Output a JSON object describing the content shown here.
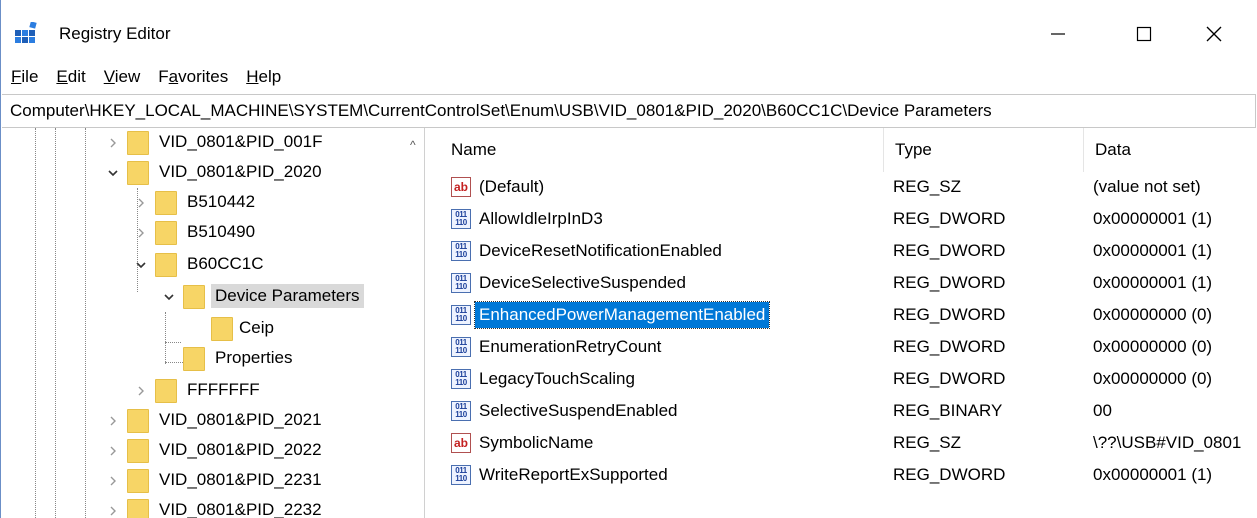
{
  "window": {
    "title": "Registry Editor",
    "controls": {
      "minimize": "—",
      "maximize": "☐",
      "close": "✕"
    }
  },
  "menu": [
    "File",
    "Edit",
    "View",
    "Favorites",
    "Help"
  ],
  "menu_mnemonics": [
    "F",
    "E",
    "V",
    "a",
    "H"
  ],
  "address": "Computer\\HKEY_LOCAL_MACHINE\\SYSTEM\\CurrentControlSet\\Enum\\USB\\VID_0801&PID_2020\\B60CC1C\\Device Parameters",
  "tree": {
    "items": [
      {
        "label": "VID_0801&PID_001F",
        "expanded": false
      },
      {
        "label": "VID_0801&PID_2020",
        "expanded": true
      },
      {
        "label": "B510442",
        "expanded": false
      },
      {
        "label": "B510490",
        "expanded": false
      },
      {
        "label": "B60CC1C",
        "expanded": true
      },
      {
        "label": "Device Parameters",
        "expanded": true,
        "selected": true
      },
      {
        "label": "Ceip"
      },
      {
        "label": "Properties"
      },
      {
        "label": "FFFFFFF",
        "expanded": false
      },
      {
        "label": "VID_0801&PID_2021",
        "expanded": false
      },
      {
        "label": "VID_0801&PID_2022",
        "expanded": false
      },
      {
        "label": "VID_0801&PID_2231",
        "expanded": false
      },
      {
        "label": "VID_0801&PID_2232",
        "expanded": false
      }
    ]
  },
  "values_pane": {
    "headers": {
      "name": "Name",
      "type": "Type",
      "data": "Data"
    },
    "rows": [
      {
        "icon": "string-value-icon",
        "name": "(Default)",
        "type": "REG_SZ",
        "data": "(value not set)"
      },
      {
        "icon": "binary-value-icon",
        "name": "AllowIdleIrpInD3",
        "type": "REG_DWORD",
        "data": "0x00000001 (1)"
      },
      {
        "icon": "binary-value-icon",
        "name": "DeviceResetNotificationEnabled",
        "type": "REG_DWORD",
        "data": "0x00000001 (1)"
      },
      {
        "icon": "binary-value-icon",
        "name": "DeviceSelectiveSuspended",
        "type": "REG_DWORD",
        "data": "0x00000001 (1)"
      },
      {
        "icon": "binary-value-icon",
        "name": "EnhancedPowerManagementEnabled",
        "type": "REG_DWORD",
        "data": "0x00000000 (0)",
        "selected": true
      },
      {
        "icon": "binary-value-icon",
        "name": "EnumerationRetryCount",
        "type": "REG_DWORD",
        "data": "0x00000000 (0)"
      },
      {
        "icon": "binary-value-icon",
        "name": "LegacyTouchScaling",
        "type": "REG_DWORD",
        "data": "0x00000000 (0)"
      },
      {
        "icon": "binary-value-icon",
        "name": "SelectiveSuspendEnabled",
        "type": "REG_BINARY",
        "data": "00"
      },
      {
        "icon": "string-value-icon",
        "name": "SymbolicName",
        "type": "REG_SZ",
        "data": "\\??\\USB#VID_0801"
      },
      {
        "icon": "binary-value-icon",
        "name": "WriteReportExSupported",
        "type": "REG_DWORD",
        "data": "0x00000001 (1)"
      }
    ]
  },
  "colors": {
    "selection": "#0078d7",
    "tree_selection": "#d9d9d9",
    "folder": "#f7d566"
  }
}
